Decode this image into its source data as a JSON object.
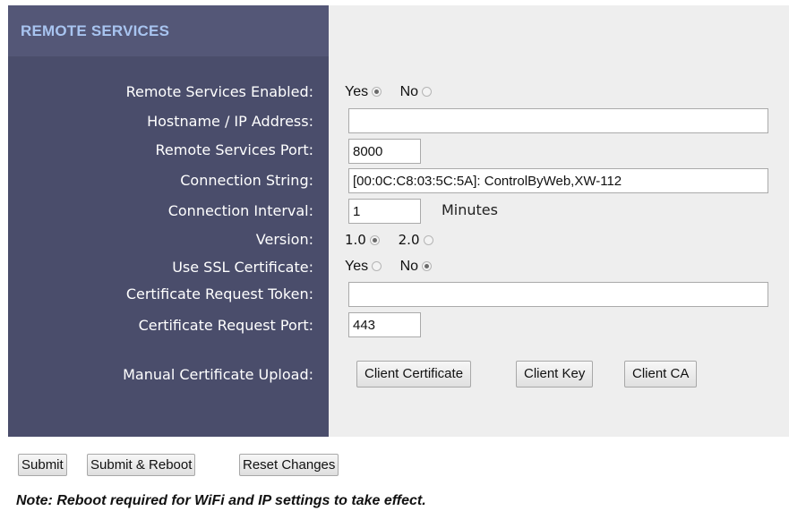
{
  "section": {
    "title": "REMOTE SERVICES"
  },
  "fields": {
    "remote_enabled": {
      "label": "Remote Services Enabled:",
      "yes": "Yes",
      "no": "No",
      "selected": "Yes"
    },
    "hostname": {
      "label": "Hostname / IP Address:",
      "value": ""
    },
    "port": {
      "label": "Remote Services Port:",
      "value": "8000"
    },
    "connection_string": {
      "label": "Connection String:",
      "value": "[00:0C:C8:03:5C:5A]: ControlByWeb,XW-112"
    },
    "connection_interval": {
      "label": "Connection Interval:",
      "value": "1",
      "unit": "Minutes"
    },
    "version": {
      "label": "Version:",
      "opt1": "1.0",
      "opt2": "2.0",
      "selected": "1.0"
    },
    "use_ssl": {
      "label": "Use SSL Certificate:",
      "yes": "Yes",
      "no": "No",
      "selected": "No"
    },
    "cert_token": {
      "label": "Certificate Request Token:",
      "value": ""
    },
    "cert_port": {
      "label": "Certificate Request Port:",
      "value": "443"
    },
    "manual_upload": {
      "label": "Manual Certificate Upload:",
      "client_certificate": "Client Certificate",
      "client_key": "Client Key",
      "client_ca": "Client CA"
    }
  },
  "actions": {
    "submit": "Submit",
    "submit_reboot": "Submit & Reboot",
    "reset": "Reset Changes"
  },
  "note": "Note: Reboot required for WiFi and IP settings to take effect.",
  "colors": {
    "label_panel": "#4a4d6b",
    "title_bar": "#545777",
    "title_text": "#a8c4f0",
    "field_panel": "#eeeeee"
  }
}
